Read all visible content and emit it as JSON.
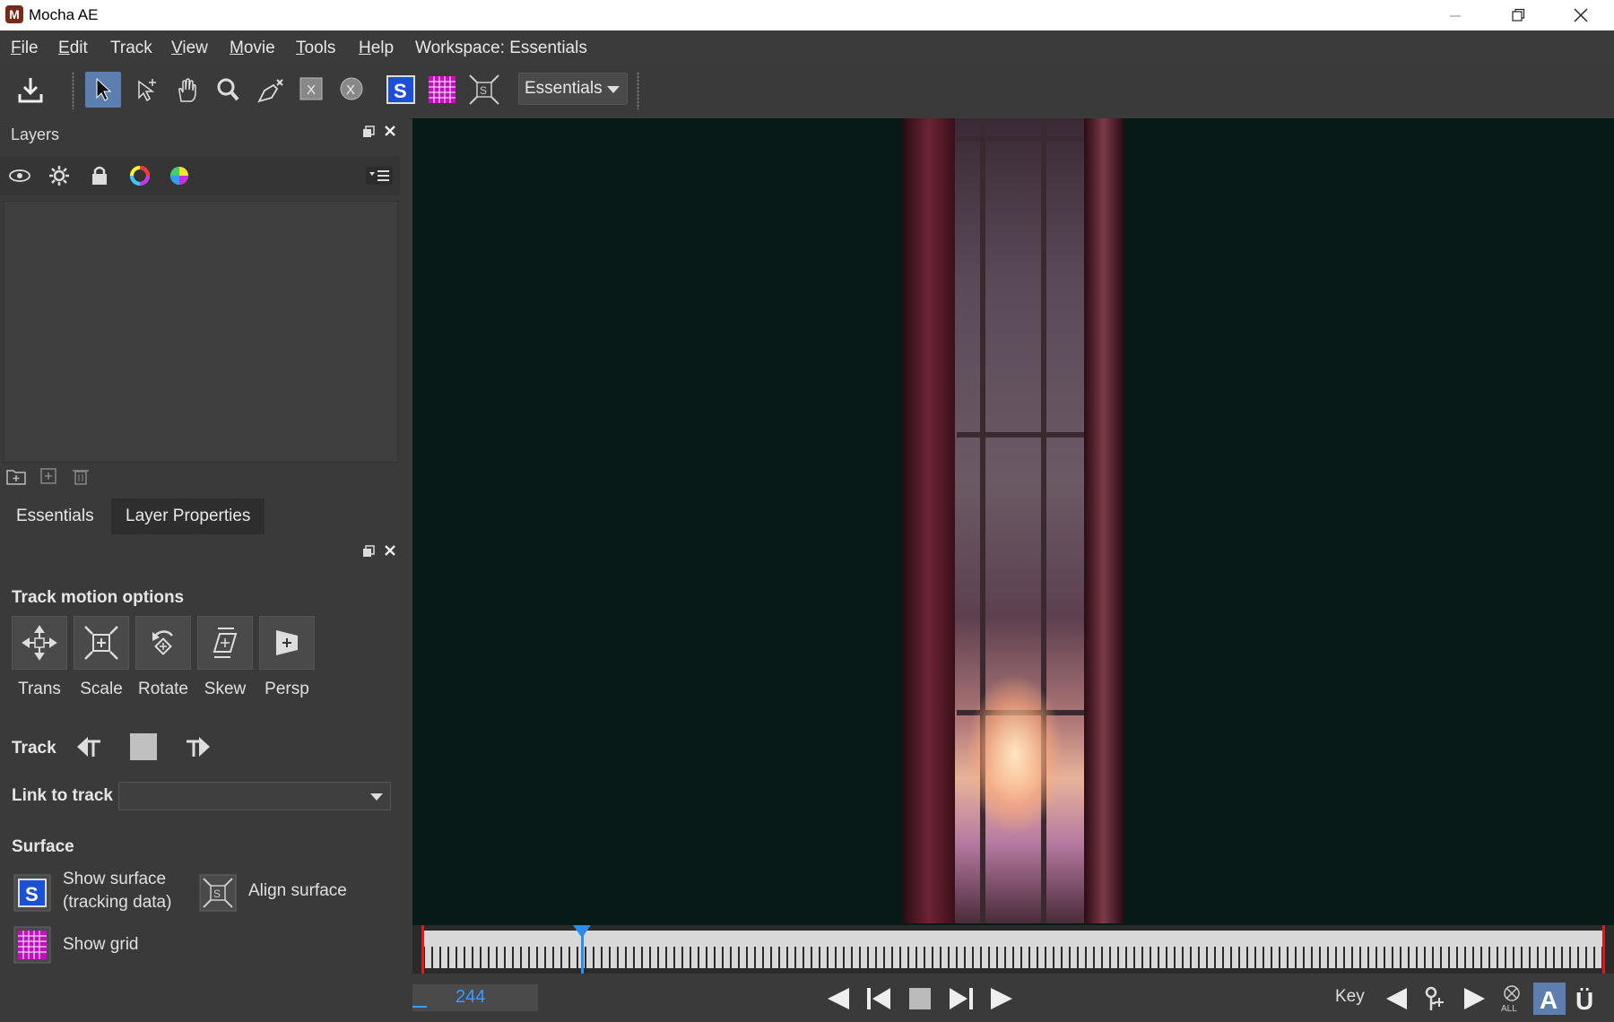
{
  "window": {
    "title": "Mocha AE",
    "app_icon_letter": "M",
    "controls": [
      "minimize",
      "restore",
      "close"
    ]
  },
  "menu": {
    "items": [
      {
        "label": "File",
        "mnemonic": "F",
        "rest": "ile"
      },
      {
        "label": "Edit",
        "mnemonic": "E",
        "rest": "dit"
      },
      {
        "label": "Track",
        "mnemonic": "",
        "rest": "Track"
      },
      {
        "label": "View",
        "mnemonic": "V",
        "rest": "iew"
      },
      {
        "label": "Movie",
        "mnemonic": "M",
        "rest": "ovie"
      },
      {
        "label": "Tools",
        "mnemonic": "T",
        "rest": "ools"
      },
      {
        "label": "Help",
        "mnemonic": "H",
        "rest": "elp"
      }
    ],
    "workspace_label": "Workspace: Essentials"
  },
  "toolbar": {
    "tools": [
      "save-icon",
      "select-tool-icon",
      "select-add-tool-icon",
      "hand-tool-icon",
      "zoom-tool-icon",
      "pen-tool-icon",
      "x-spline-tool-icon",
      "bezier-tool-icon",
      "surface-toggle-icon",
      "grid-toggle-icon",
      "align-surface-icon"
    ],
    "workspace_dropdown": "Essentials"
  },
  "layers_panel": {
    "title": "Layers",
    "toolbar_icons": [
      "eye-icon",
      "gear-icon",
      "lock-icon",
      "color-ring-icon",
      "color-wheel-icon",
      "layer-menu-icon"
    ],
    "bottom_icons": [
      "new-folder-icon",
      "new-layer-icon",
      "trash-icon"
    ]
  },
  "tabs": {
    "essentials": "Essentials",
    "layer_properties": "Layer Properties"
  },
  "properties": {
    "track_motion_title": "Track motion options",
    "motion_buttons": [
      {
        "label": "Trans",
        "icon": "translate-icon"
      },
      {
        "label": "Scale",
        "icon": "scale-icon"
      },
      {
        "label": "Rotate",
        "icon": "rotate-icon"
      },
      {
        "label": "Skew",
        "icon": "skew-icon"
      },
      {
        "label": "Persp",
        "icon": "perspective-icon"
      }
    ],
    "track_label": "Track",
    "link_to_track_label": "Link to track",
    "link_to_track_value": "",
    "surface_title": "Surface",
    "show_surface_line1": "Show surface",
    "show_surface_line2": "(tracking data)",
    "align_surface": "Align surface",
    "show_grid": "Show grid"
  },
  "timeline": {
    "current_frame": "244",
    "key_label": "Key"
  },
  "colors": {
    "accent": "#5d7fb0",
    "playhead": "#2a8cf0",
    "frame_text": "#3d9bff",
    "in_out_marker": "#e01818",
    "viewer_bg": "#071a18"
  }
}
